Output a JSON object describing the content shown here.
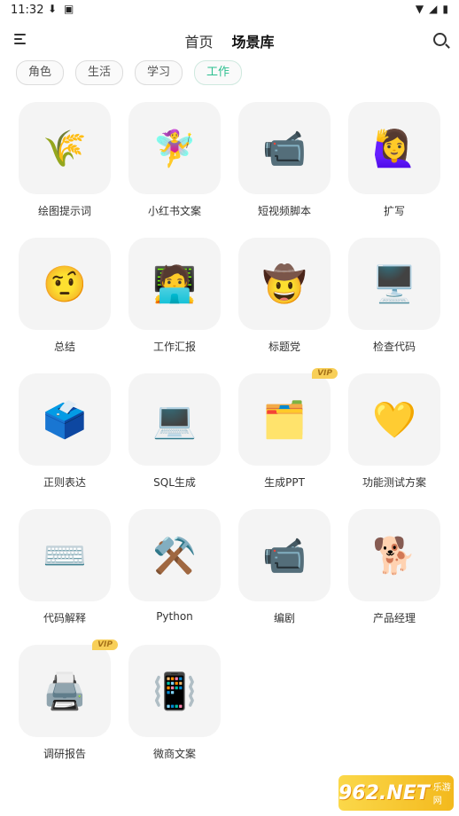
{
  "status_bar": {
    "time": "11:32"
  },
  "header": {
    "tabs": [
      "首页",
      "场景库"
    ],
    "active_tab": "场景库"
  },
  "chips": [
    {
      "label": "角色",
      "active": false
    },
    {
      "label": "生活",
      "active": false
    },
    {
      "label": "学习",
      "active": false
    },
    {
      "label": "工作",
      "active": true
    }
  ],
  "items": [
    {
      "label": "绘图提示词",
      "icon": "🌾",
      "vip": false
    },
    {
      "label": "小红书文案",
      "icon": "🧚‍♀️",
      "vip": false
    },
    {
      "label": "短视频脚本",
      "icon": "📹",
      "vip": false
    },
    {
      "label": "扩写",
      "icon": "🙋‍♀️",
      "vip": false
    },
    {
      "label": "总结",
      "icon": "🤨",
      "vip": false
    },
    {
      "label": "工作汇报",
      "icon": "🧑‍💻",
      "vip": false
    },
    {
      "label": "标题党",
      "icon": "🤠",
      "vip": false
    },
    {
      "label": "检查代码",
      "icon": "🖥️",
      "vip": false
    },
    {
      "label": "正则表达",
      "icon": "🗳️",
      "vip": false
    },
    {
      "label": "SQL生成",
      "icon": "💻",
      "vip": false
    },
    {
      "label": "生成PPT",
      "icon": "🗂️",
      "vip": true
    },
    {
      "label": "功能测试方案",
      "icon": "💛",
      "vip": false
    },
    {
      "label": "代码解释",
      "icon": "⌨️",
      "vip": false
    },
    {
      "label": "Python",
      "icon": "⚒️",
      "vip": false
    },
    {
      "label": "编剧",
      "icon": "📹",
      "vip": false
    },
    {
      "label": "产品经理",
      "icon": "🐕",
      "vip": false
    },
    {
      "label": "调研报告",
      "icon": "🖨️",
      "vip": true
    },
    {
      "label": "微商文案",
      "icon": "📳",
      "vip": false
    }
  ],
  "vip_badge": "VIP",
  "watermark": {
    "main": "962.NET",
    "sub": "乐游网"
  }
}
